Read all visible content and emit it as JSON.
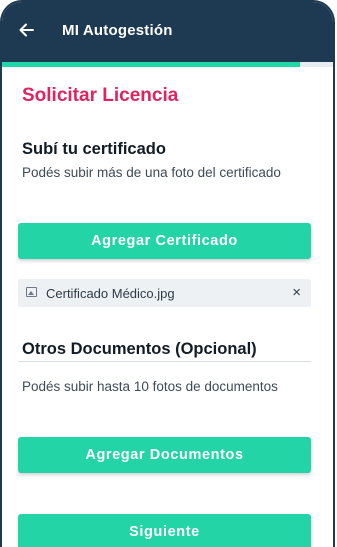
{
  "appbar": {
    "back_icon": "arrow-left-icon",
    "title": "MI Autogestión",
    "progress": 0.9,
    "color": "#1d3a52"
  },
  "page": {
    "title": "Solicitar Licencia"
  },
  "certificate": {
    "heading": "Subí tu certificado",
    "description": "Podés subir más de una foto del certificado",
    "button": "Agregar Certificado",
    "files": [
      {
        "icon": "image-icon",
        "name": "Certificado Médico.jpg",
        "remove": "×"
      }
    ]
  },
  "documents": {
    "heading": "Otros Documentos (Opcional)",
    "description": "Podés subir hasta 10 fotos de documentos",
    "button": "Agregar Documentos"
  },
  "footer": {
    "next_button": "Siguiente"
  },
  "colors": {
    "accent": "#22d4a6",
    "title": "#e0245e"
  }
}
